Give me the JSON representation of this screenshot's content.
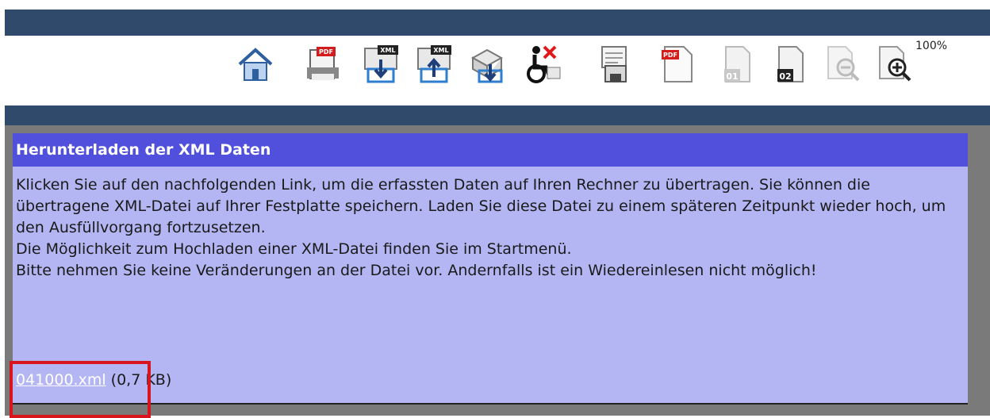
{
  "toolbar": {
    "icons": [
      {
        "name": "home-icon"
      },
      {
        "name": "pdf-print-icon",
        "badge": "PDF"
      },
      {
        "name": "xml-download-icon",
        "badge": "XML"
      },
      {
        "name": "xml-upload-icon",
        "badge": "XML"
      },
      {
        "name": "package-download-icon"
      },
      {
        "name": "accessibility-off-icon"
      },
      {
        "name": "save-document-icon"
      },
      {
        "name": "pdf-document-icon",
        "badge": "PDF"
      },
      {
        "name": "page-01-icon",
        "badge": "01"
      },
      {
        "name": "page-02-icon",
        "badge": "02"
      },
      {
        "name": "zoom-out-icon"
      },
      {
        "name": "zoom-in-icon"
      }
    ],
    "zoom_level": "100%"
  },
  "panel": {
    "title": "Herunterladen der XML Daten",
    "paragraphs": [
      "Klicken Sie auf den nachfolgenden Link, um die erfassten Daten auf Ihren Rechner zu übertragen. Sie können die übertragene XML-Datei auf Ihrer Festplatte speichern. Laden Sie diese Datei zu einem späteren Zeitpunkt wieder hoch, um den Ausfüllvorgang fortzusetzen.",
      "Die Möglichkeit zum Hochladen einer XML-Datei finden Sie im Startmenü.",
      "Bitte nehmen Sie keine Veränderungen an der Datei vor. Andernfalls ist ein Wiedereinlesen nicht möglich!"
    ],
    "file_link": "041000.xml",
    "file_size": "(0,7 KB)"
  },
  "colors": {
    "header_bar": "#2f4a6a",
    "panel_header": "#5050dd",
    "panel_bg": "#b3b6f2",
    "highlight": "#d8141c"
  }
}
